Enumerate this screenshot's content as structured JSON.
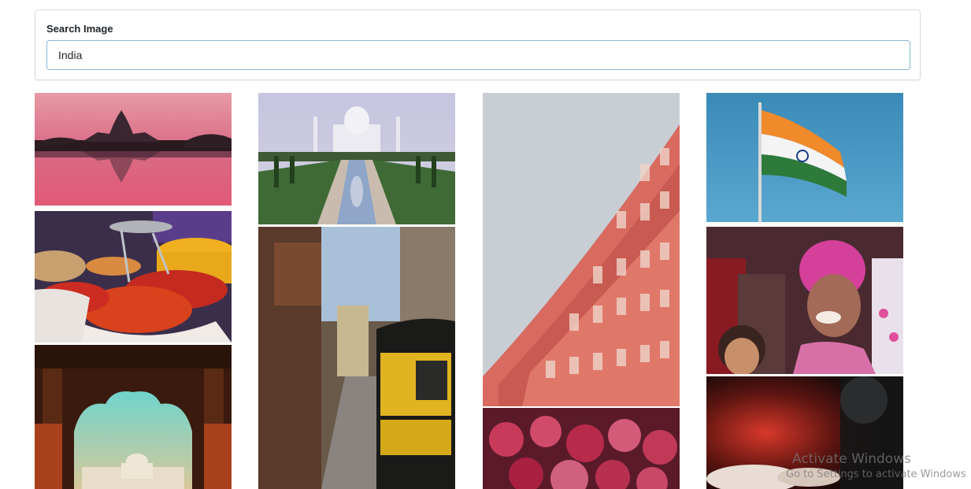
{
  "search": {
    "label": "Search Image",
    "value": "India",
    "accent_color": "#86b7d6"
  },
  "gallery": {
    "query": "India",
    "images": [
      {
        "subject": "Victoria Memorial at pink sunset with reflection",
        "column": 1
      },
      {
        "subject": "Spice market with colorful powders",
        "column": 1
      },
      {
        "subject": "Taj Mahal seen through carved arch",
        "column": 1
      },
      {
        "subject": "Taj Mahal with reflecting pool",
        "column": 2
      },
      {
        "subject": "Narrow street with yellow auto rickshaw",
        "column": 2
      },
      {
        "subject": "Hawa Mahal pink palace facade",
        "column": 3
      },
      {
        "subject": "Holi festival crowd with colored powder",
        "column": 3
      },
      {
        "subject": "Indian flag waving against blue sky",
        "column": 4
      },
      {
        "subject": "Smiling girl with pink Holi powder",
        "column": 4
      },
      {
        "subject": "Dark red close-up with hands",
        "column": 4
      }
    ]
  },
  "watermark": {
    "title": "Activate Windows",
    "subtitle": "Go to Settings to activate Windows"
  }
}
